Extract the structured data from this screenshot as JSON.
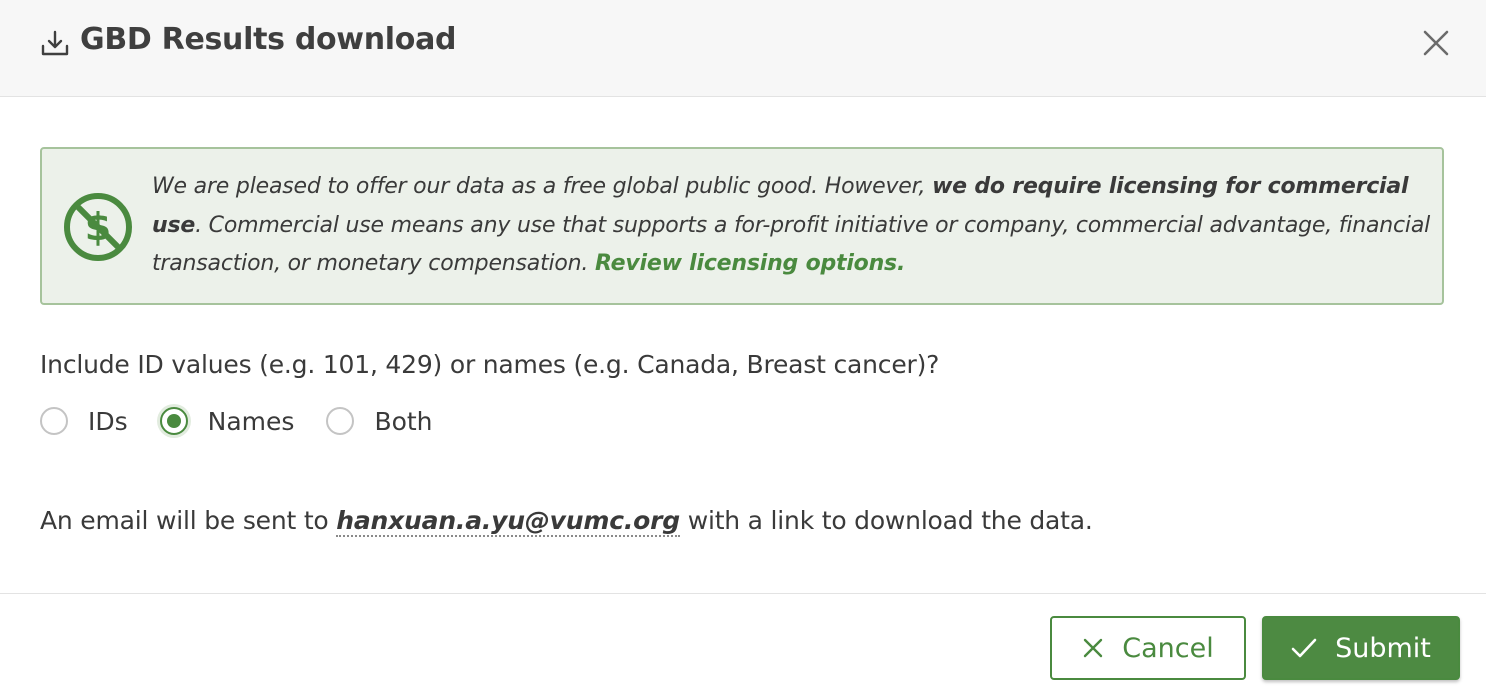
{
  "header": {
    "title": "GBD Results download",
    "download_icon": "download-icon",
    "close_icon": "close-icon"
  },
  "notice": {
    "icon": "no-dollar-icon",
    "text_part1": "We are pleased to offer our data as a free global public good. However, ",
    "text_bold": "we do require licensing for commercial use",
    "text_part2": ". Commercial use means any use that supports a for-profit initiative or company, commercial advantage, financial transaction, or monetary compensation. ",
    "link_label": "Review licensing options."
  },
  "question": {
    "label": "Include ID values (e.g. 101, 429) or names (e.g. Canada, Breast cancer)?",
    "options": [
      {
        "label": "IDs",
        "checked": false
      },
      {
        "label": "Names",
        "checked": true
      },
      {
        "label": "Both",
        "checked": false
      }
    ]
  },
  "email_notice": {
    "prefix": "An email will be sent to ",
    "email": "hanxuan.a.yu@vumc.org",
    "suffix": " with a link to download the data."
  },
  "footer": {
    "cancel_label": "Cancel",
    "submit_label": "Submit"
  },
  "colors": {
    "accent": "#4a8a3f",
    "notice_bg": "#ecf1ea",
    "notice_border": "#a6c39c",
    "header_bg": "#f7f7f7"
  }
}
